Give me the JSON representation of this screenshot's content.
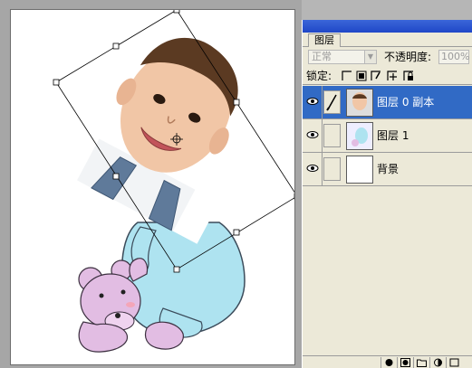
{
  "palette": {
    "tab_label": "图层",
    "blend_mode": "正常",
    "opacity_label": "不透明度:",
    "opacity_value": "100%",
    "lock_label": "锁定:"
  },
  "layers": [
    {
      "name": "图层 0 副本",
      "visible": true,
      "selected": true
    },
    {
      "name": "图层 1",
      "visible": true,
      "selected": false
    },
    {
      "name": "背景",
      "visible": true,
      "selected": false
    }
  ],
  "icons": {
    "eye": "eye-icon",
    "brush": "brush-icon",
    "lock_transparent": "lock-transparent-icon",
    "lock_image": "lock-image-icon",
    "lock_position": "lock-position-icon",
    "lock_all": "lock-all-icon"
  },
  "colors": {
    "selection": "#316ac5",
    "panel": "#ece9d8",
    "titlebar": "#1f47c7"
  }
}
